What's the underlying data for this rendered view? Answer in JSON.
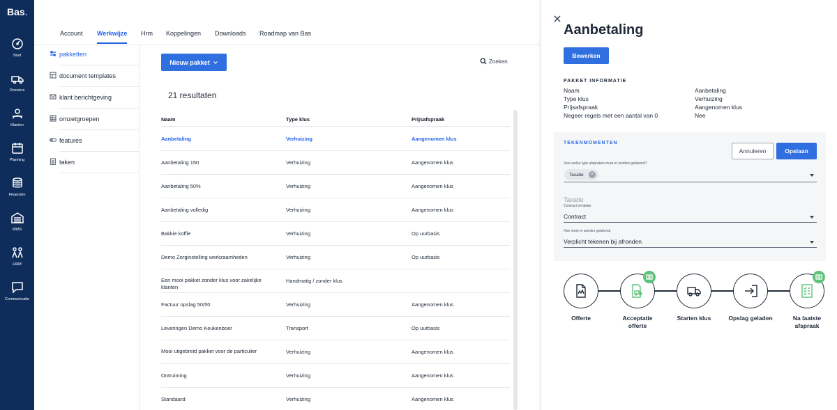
{
  "app": {
    "logo": "Bas",
    "accent": "#2f6fe0",
    "sidebar_bg": "#0f2d5b"
  },
  "sidebar": {
    "items": [
      {
        "label": "Start",
        "icon": "gauge-icon"
      },
      {
        "label": "Dossiers",
        "icon": "truck-icon"
      },
      {
        "label": "Klanten",
        "icon": "users-icon"
      },
      {
        "label": "Planning",
        "icon": "calendar-icon"
      },
      {
        "label": "Financiën",
        "icon": "coins-icon"
      },
      {
        "label": "WMS",
        "icon": "warehouse-icon"
      },
      {
        "label": "HRM",
        "icon": "people-icon"
      },
      {
        "label": "Communicatie",
        "icon": "chat-icon"
      }
    ]
  },
  "tabs": [
    {
      "label": "Account"
    },
    {
      "label": "Werkwijze",
      "active": true
    },
    {
      "label": "Hrm"
    },
    {
      "label": "Koppelingen"
    },
    {
      "label": "Downloads"
    },
    {
      "label": "Roadmap van Bas"
    }
  ],
  "subnav": [
    {
      "label": "pakketten",
      "icon": "sliders-icon",
      "active": true
    },
    {
      "label": "document templates",
      "icon": "template-icon"
    },
    {
      "label": "klant berichtgeving",
      "icon": "mail-icon"
    },
    {
      "label": "omzetgroepen",
      "icon": "table-icon"
    },
    {
      "label": "features",
      "icon": "toggle-icon"
    },
    {
      "label": "taken",
      "icon": "clipboard-icon"
    }
  ],
  "list": {
    "new_button": "Nieuw pakket",
    "search_label": "Zoeken",
    "results": "21 resultaten",
    "columns": [
      "Naam",
      "Type klus",
      "Prijsafspraak"
    ],
    "rows": [
      [
        "Aanbetaling",
        "Verhuizing",
        "Aangenomen klus"
      ],
      [
        "Aanbetaling 150",
        "Verhuizing",
        "Aangenomen klus"
      ],
      [
        "Aanbetaling 50%",
        "Verhuizing",
        "Aangenomen klus"
      ],
      [
        "Aanbetaling volledig",
        "Verhuizing",
        "Aangenomen klus"
      ],
      [
        "Bakkie koffie",
        "Verhuizing",
        "Op uurbasis"
      ],
      [
        "Demo Zorginstelling werkzaamheden",
        "Verhuizing",
        "Op uurbasis"
      ],
      [
        "Een mooi pakket zonder klus voor zakelijke klanten",
        "Handmatig / zonder klus",
        ""
      ],
      [
        "Factuur opslag 50/50",
        "Verhuizing",
        "Aangenomen klus"
      ],
      [
        "Leveringen Demo Keukenboer",
        "Transport",
        "Op uurbasis"
      ],
      [
        "Mooi uitgebreid pakket voor de particulier",
        "Verhuizing",
        "Aangenomen klus"
      ],
      [
        "Ontruiming",
        "Verhuizing",
        "Aangenomen klus"
      ],
      [
        "Standaard",
        "Verhuizing",
        "Aangenomen klus"
      ]
    ]
  },
  "panel": {
    "title": "Aanbetaling",
    "edit_button": "Bewerken",
    "info_title": "PAKKET INFORMATIE",
    "info": [
      {
        "label": "Naam",
        "value": "Aanbetaling"
      },
      {
        "label": "Type klus",
        "value": "Verhuizing"
      },
      {
        "label": "Prijsafspraak",
        "value": "Aangenomen klus"
      },
      {
        "label": "Negeer regels met een aantal van 0",
        "value": "Nee"
      }
    ],
    "tekenmomenten": {
      "title": "TEKENMOMENTEN",
      "cancel": "Annuleren",
      "save": "Opslaan",
      "field1_label": "Voor welke type afspraken moet er worden getekend?",
      "chip": "Taxatie",
      "ghost_label": "Taxatie",
      "field2_label": "Contract template",
      "field2_value": "Contract",
      "field3_label": "Hoe moet er worden getekend",
      "field3_value": "Verplicht tekenen bij afronden"
    },
    "flow": [
      {
        "label": "Offerte",
        "icon": "document-chart-icon",
        "color": "#1f2937",
        "badge": false
      },
      {
        "label": "Acceptatie offerte",
        "icon": "truck-document-icon",
        "color": "#5ec27a",
        "badge": true
      },
      {
        "label": "Starten klus",
        "icon": "truck-icon",
        "color": "#1f2937",
        "badge": false
      },
      {
        "label": "Opslag geladen",
        "icon": "import-icon",
        "color": "#1f2937",
        "badge": false
      },
      {
        "label": "Na laatste afspraak",
        "icon": "checklist-icon",
        "color": "#5ec27a",
        "badge": true
      }
    ]
  }
}
